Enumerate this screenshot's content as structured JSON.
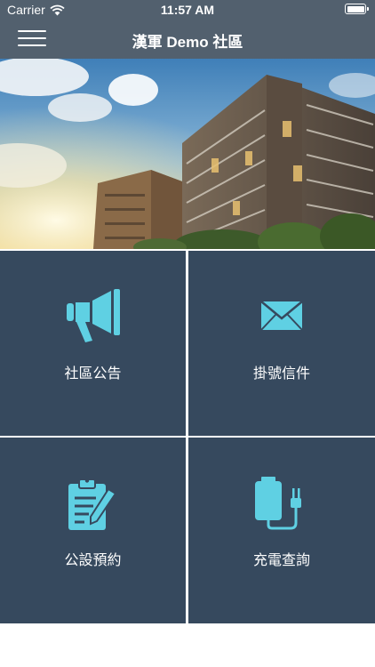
{
  "status_bar": {
    "carrier": "Carrier",
    "time": "11:57 AM"
  },
  "nav": {
    "title": "漢軍 Demo 社區",
    "menu_icon": "hamburger-menu-icon"
  },
  "banner": {
    "image": "apartment-buildings-photo"
  },
  "tiles": [
    {
      "label": "社區公告",
      "icon": "megaphone-icon"
    },
    {
      "label": "掛號信件",
      "icon": "envelope-icon"
    },
    {
      "label": "公設預約",
      "icon": "clipboard-pen-icon"
    },
    {
      "label": "充電查詢",
      "icon": "battery-charger-icon"
    }
  ],
  "colors": {
    "nav_bg": "#52606e",
    "tile_bg": "#36495e",
    "icon_accent": "#5fd0e3",
    "divider": "#ffffff"
  }
}
